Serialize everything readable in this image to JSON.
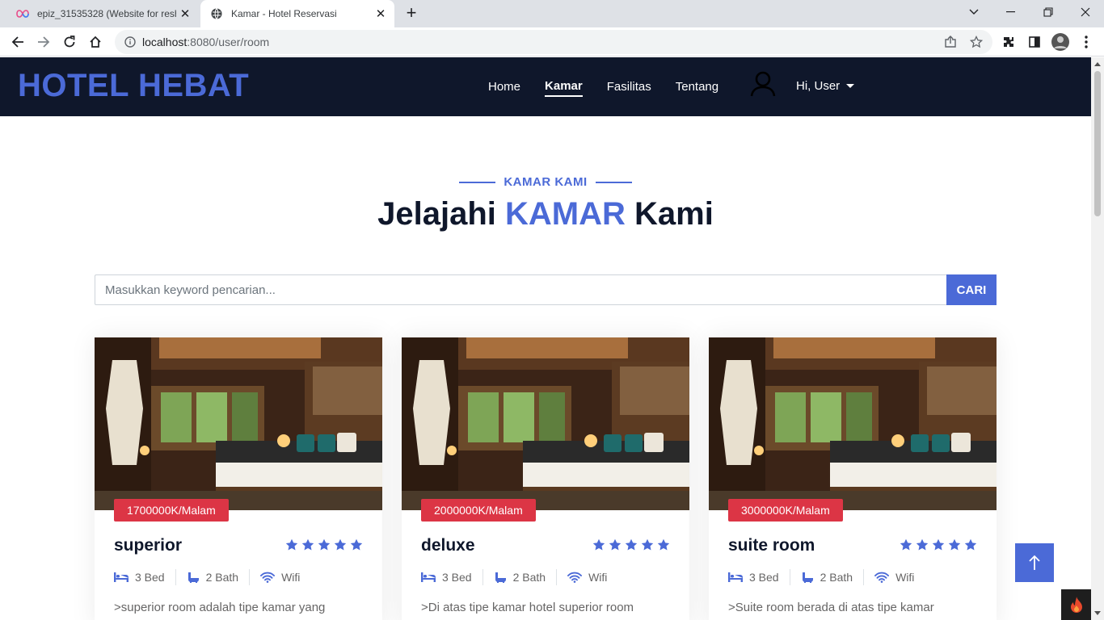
{
  "browser": {
    "tabs": [
      {
        "title": "epiz_31535328 (Website for resh…"
      },
      {
        "title": "Kamar - Hotel Reservasi"
      }
    ],
    "url_host": "localhost",
    "url_path": ":8080/user/room"
  },
  "nav": {
    "brand": "HOTEL HEBAT",
    "links": [
      {
        "label": "Home"
      },
      {
        "label": "Kamar"
      },
      {
        "label": "Fasilitas"
      },
      {
        "label": "Tentang"
      }
    ],
    "user_label": "Hi, User"
  },
  "section": {
    "eyebrow": "KAMAR KAMI",
    "title_pre": "Jelajahi ",
    "title_accent": "KAMAR",
    "title_post": " Kami"
  },
  "search": {
    "placeholder": "Masukkan keyword pencarian...",
    "button": "CARI"
  },
  "rooms": [
    {
      "price": "1700000K/Malam",
      "name": "superior",
      "rating": 5,
      "bed": "3 Bed",
      "bath": "2 Bath",
      "wifi": "Wifi",
      "desc": ">superior room adalah tipe kamar yang"
    },
    {
      "price": "2000000K/Malam",
      "name": "deluxe",
      "rating": 5,
      "bed": "3 Bed",
      "bath": "2 Bath",
      "wifi": "Wifi",
      "desc": ">Di atas tipe kamar hotel superior room"
    },
    {
      "price": "3000000K/Malam",
      "name": "suite room",
      "rating": 5,
      "bed": "3 Bed",
      "bath": "2 Bath",
      "wifi": "Wifi",
      "desc": ">Suite room berada di atas tipe kamar"
    }
  ],
  "colors": {
    "accent": "#4b6ad7",
    "navy": "#0f172b",
    "price": "#dc3545"
  }
}
